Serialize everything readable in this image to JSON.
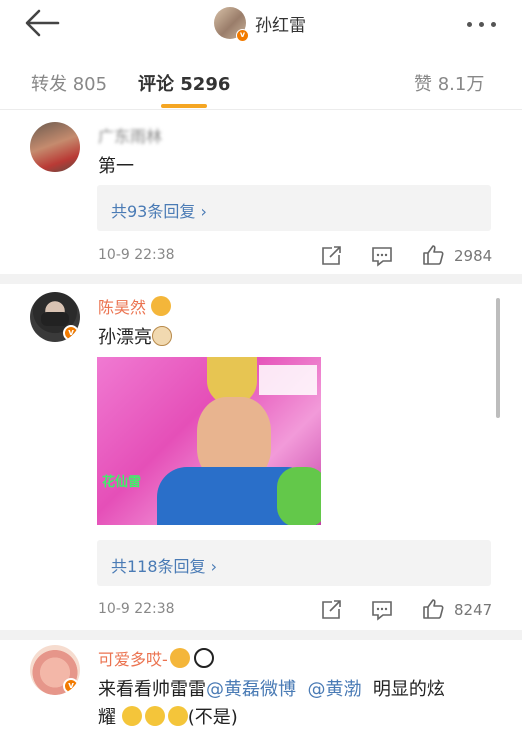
{
  "header": {
    "title": "孙红雷",
    "back_icon": "back-arrow-icon",
    "more_icon": "more-dots-icon"
  },
  "tabs": [
    {
      "label": "转发 805"
    },
    {
      "label": "评论 5296"
    },
    {
      "label": "赞 8.1万"
    }
  ],
  "accent_color": "#f5a623",
  "comments": [
    {
      "name": "广东雨林",
      "text": "第一",
      "replies": "共93条回复 ›",
      "time": "10-9 22:38",
      "likes": "2984"
    },
    {
      "name": "陈昊然",
      "text": "孙漂亮",
      "image_caption": "花仙雷",
      "replies": "共118条回复 ›",
      "time": "10-9 22:38",
      "likes": "8247"
    },
    {
      "name": "可爱多哎-",
      "text_prefix": "来看看帅雷雷",
      "mention1": "@黄磊微博",
      "mention2": "@黄渤",
      "text_suffix": "明显的炫",
      "text_line2": "耀",
      "text_line2_end": "(不是)"
    }
  ]
}
